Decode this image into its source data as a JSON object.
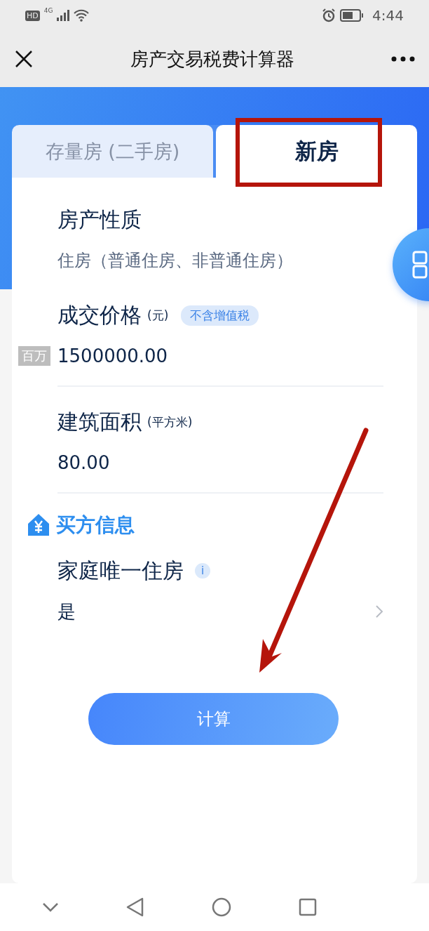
{
  "status_bar": {
    "hd": "HD",
    "network": "4G",
    "time": "4:44"
  },
  "nav": {
    "title": "房产交易税费计算器"
  },
  "tabs": [
    {
      "label": "存量房 (二手房)",
      "selected": false
    },
    {
      "label": "新房",
      "selected": true
    }
  ],
  "fields": [
    {
      "kind": "select",
      "label": "房产性质",
      "value": "住房（普通住房、非普通住房）"
    },
    {
      "kind": "input",
      "label": "成交价格",
      "unit": "(元)",
      "badge": "不含增值税",
      "hint": "百万",
      "value": "1500000.00"
    },
    {
      "kind": "input",
      "label": "建筑面积",
      "unit": "(平方米)",
      "value": "80.00"
    }
  ],
  "buyer_section": {
    "title": "买方信息",
    "fields": [
      {
        "kind": "chevron",
        "label": "家庭唯一住房",
        "info": "i",
        "value": "是"
      }
    ]
  },
  "calculate_button": "计算"
}
